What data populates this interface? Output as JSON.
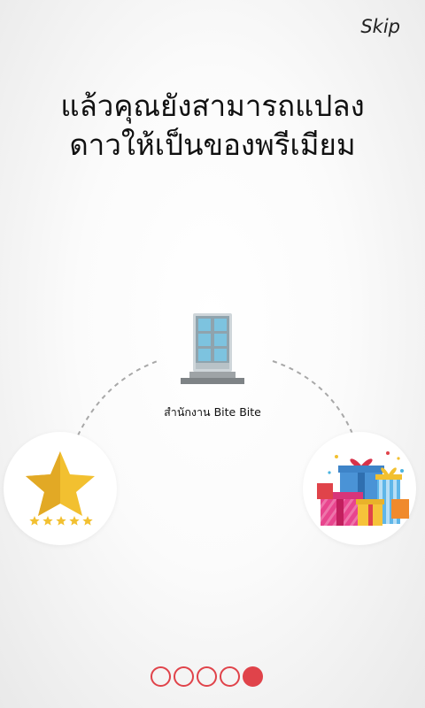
{
  "header": {
    "skip_label": "Skip"
  },
  "headline": {
    "line1": "แล้วคุณยังสามารถแปลง",
    "line2": "ดาวให้เป็นของพรีเมียม"
  },
  "office": {
    "label": "สำนักงาน Bite Bite",
    "icon": "building-door-icon"
  },
  "left_item": {
    "icon": "star-icon",
    "rating_stars": 5,
    "accent": "#f2c030"
  },
  "right_item": {
    "icon": "gift-boxes-icon"
  },
  "pagination": {
    "total": 5,
    "active_index": 4,
    "color": "#e0434a"
  }
}
